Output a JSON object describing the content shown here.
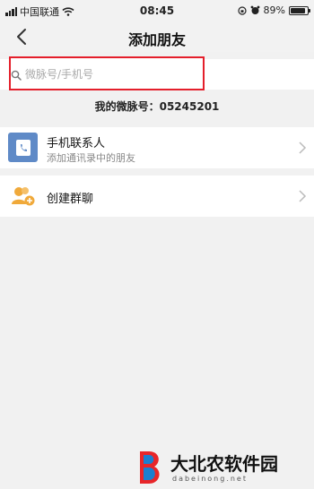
{
  "status_bar": {
    "carrier": "中国联通",
    "time": "08:45",
    "battery": "89%",
    "battery_level": 0.89
  },
  "navbar": {
    "title": "添加朋友",
    "back_icon": "chevron-left-icon"
  },
  "search": {
    "placeholder": "微脉号/手机号",
    "value": "",
    "highlight_color": "#e41f2b"
  },
  "my_id": "我的微脉号：05245201",
  "rows": [
    {
      "title": "手机联系人",
      "subtitle": "添加通讯录中的朋友",
      "icon": "phone-book-icon"
    },
    {
      "title": "创建群聊",
      "icon": "group-add-icon"
    }
  ],
  "watermark": {
    "text": "大北农软件园",
    "domain": "dabeinong.net"
  }
}
